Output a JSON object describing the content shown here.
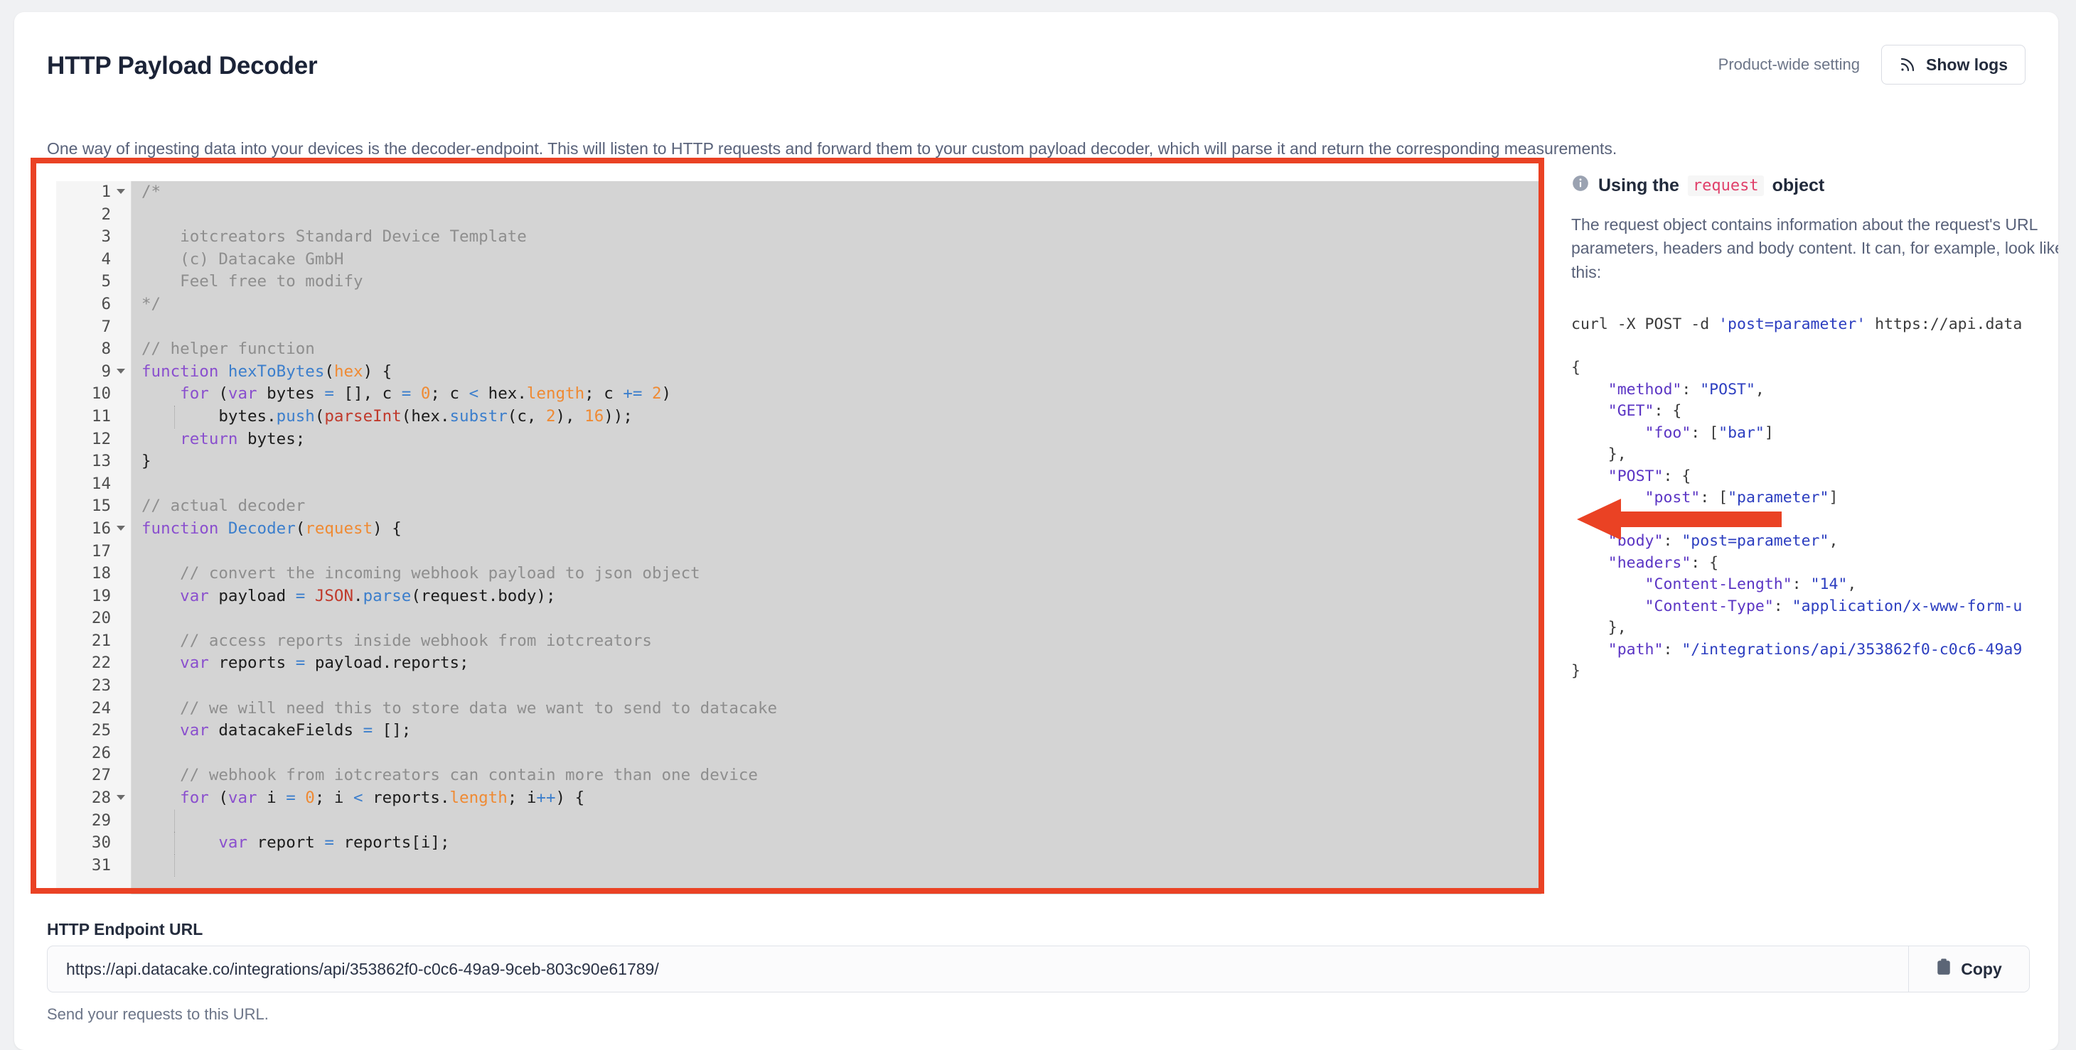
{
  "header": {
    "title": "HTTP Payload Decoder",
    "scope_label": "Product-wide setting",
    "show_logs_label": "Show logs",
    "show_logs_icon": "rss-broadcast-icon"
  },
  "description": "One way of ingesting data into your devices is the decoder-endpoint. This will listen to HTTP requests and forward them to your custom payload decoder, which will parse it and return the corresponding measurements.",
  "editor": {
    "first_visible_line": 1,
    "last_visible_line": 31,
    "fold_lines": [
      1,
      9,
      16,
      28
    ],
    "background_color": "#d4d4d4",
    "gutter_color": "#f5f5f5",
    "lines": [
      "/*",
      "",
      "    iotcreators Standard Device Template",
      "    (c) Datacake GmbH",
      "    Feel free to modify",
      "*/",
      "",
      "// helper function",
      "function hexToBytes(hex) {",
      "    for (var bytes = [], c = 0; c < hex.length; c += 2)",
      "        bytes.push(parseInt(hex.substr(c, 2), 16));",
      "    return bytes;",
      "}",
      "",
      "// actual decoder",
      "function Decoder(request) {",
      "",
      "    // convert the incoming webhook payload to json object",
      "    var payload = JSON.parse(request.body);",
      "",
      "    // access reports inside webhook from iotcreators",
      "    var reports = payload.reports;",
      "",
      "    // we will need this to store data we want to send to datacake",
      "    var datacakeFields = [];",
      "",
      "    // webhook from iotcreators can contain more than one device",
      "    for (var i = 0; i < reports.length; i++) {",
      "",
      "        var report = reports[i];",
      ""
    ]
  },
  "info_panel": {
    "icon": "info-circle-icon",
    "title_prefix": "Using the",
    "title_code": "request",
    "title_suffix": "object",
    "body": "The request object contains information about the request's URL parameters, headers and body content. It can, for example, look like this:",
    "curl_prefix": "curl -X POST -d ",
    "curl_string": "'post=parameter'",
    "curl_suffix": " https://api.data",
    "json_example": {
      "method": "POST",
      "GET": {
        "foo": [
          "bar"
        ]
      },
      "POST": {
        "post": [
          "parameter"
        ]
      },
      "body": "post=parameter",
      "headers": {
        "Content-Length": "14",
        "Content-Type": "application/x-www-form-u"
      },
      "path": "/integrations/api/353862f0-c0c6-49a9"
    }
  },
  "annotations": {
    "frame_color": "#ea4224",
    "arrow_color": "#ea4224",
    "arrow_direction": "left"
  },
  "endpoint": {
    "label": "HTTP Endpoint URL",
    "value": "https://api.datacake.co/integrations/api/353862f0-c0c6-49a9-9ceb-803c90e61789/",
    "placeholder": "https://",
    "copy_label": "Copy",
    "copy_icon": "clipboard-icon",
    "help_text": "Send your requests to this URL."
  }
}
